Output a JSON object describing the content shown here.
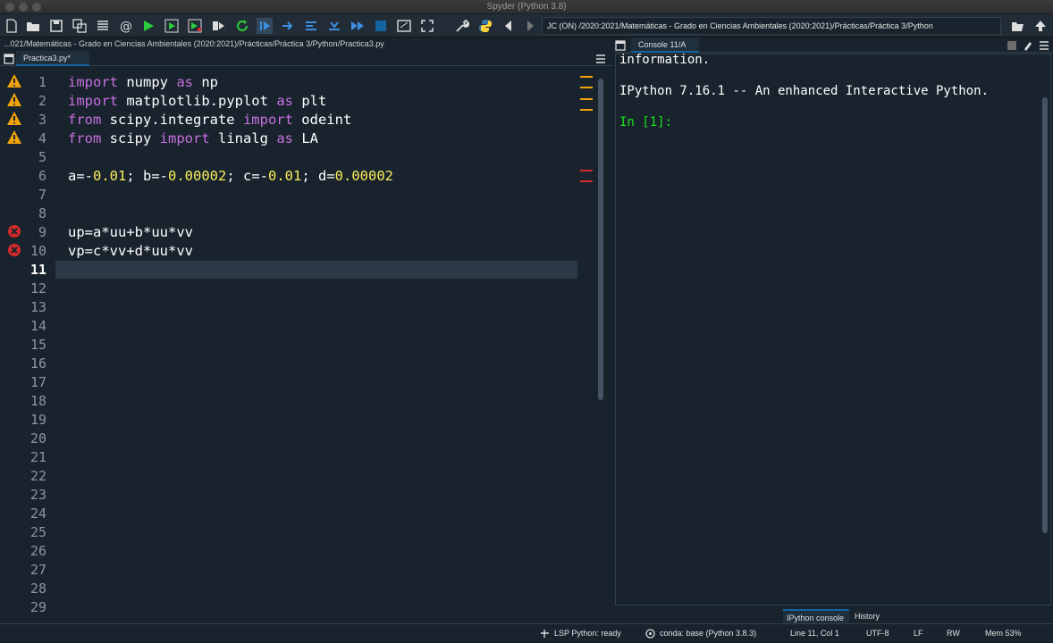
{
  "window": {
    "title": "Spyder (Python 3.8)"
  },
  "toolbar": {
    "path": "JC (ON) /2020:2021/Matemáticas - Grado en Ciencias Ambientales (2020:2021)/Prácticas/Práctica 3/Python"
  },
  "editor": {
    "file_path": "...021/Matemáticas - Grado en Ciencias Ambientales (2020:2021)/Prácticas/Práctica 3/Python/Practica3.py",
    "tab_label": "Practica3.py*",
    "line_numbers": [
      "1",
      "2",
      "3",
      "4",
      "5",
      "6",
      "7",
      "8",
      "9",
      "10",
      "11",
      "12",
      "13",
      "14",
      "15",
      "16",
      "17",
      "18",
      "19",
      "20",
      "21",
      "22",
      "23",
      "24",
      "25",
      "26",
      "27",
      "28",
      "29"
    ],
    "current_line": 11,
    "lines": {
      "l1": {
        "kw1": "import",
        "t1": " numpy ",
        "kw2": "as",
        "t2": " np"
      },
      "l2": {
        "kw1": "import",
        "t1": " matplotlib.pyplot ",
        "kw2": "as",
        "t2": " plt"
      },
      "l3": {
        "kw1": "from",
        "t1": " scipy.integrate ",
        "kw2": "import",
        "t2": " odeint"
      },
      "l4": {
        "kw1": "from",
        "t1": " scipy ",
        "kw2": "import",
        "t2": " linalg ",
        "kw3": "as",
        "t3": " LA"
      },
      "l6": {
        "p1": "a=-",
        "n1": "0.01",
        "p2": "; b=-",
        "n2": "0.00002",
        "p3": "; c=-",
        "n3": "0.01",
        "p4": "; d=",
        "n4": "0.00002"
      },
      "l9": "up=a*uu+b*uu*vv",
      "l10": "vp=c*vv+d*uu*vv"
    }
  },
  "console": {
    "tab_label": "Console 11/A",
    "line1": "information.",
    "line2": "IPython 7.16.1 -- An enhanced Interactive Python.",
    "prompt": "In [1]:"
  },
  "bottom_tabs": [
    "IPython console",
    "History"
  ],
  "status": {
    "lsp": "LSP Python: ready",
    "conda": "conda: base (Python 3.8.3)",
    "position": "Line 11, Col 1",
    "encoding": "UTF-8",
    "eol": "LF",
    "mode": "RW",
    "memory": "Mem 53%"
  },
  "colors": {
    "background": "#19232d",
    "keyword": "#c670e0",
    "number": "#faed5c",
    "prompt": "#1ce21c",
    "warning": "#f0a30a",
    "error": "#d42a2a"
  }
}
